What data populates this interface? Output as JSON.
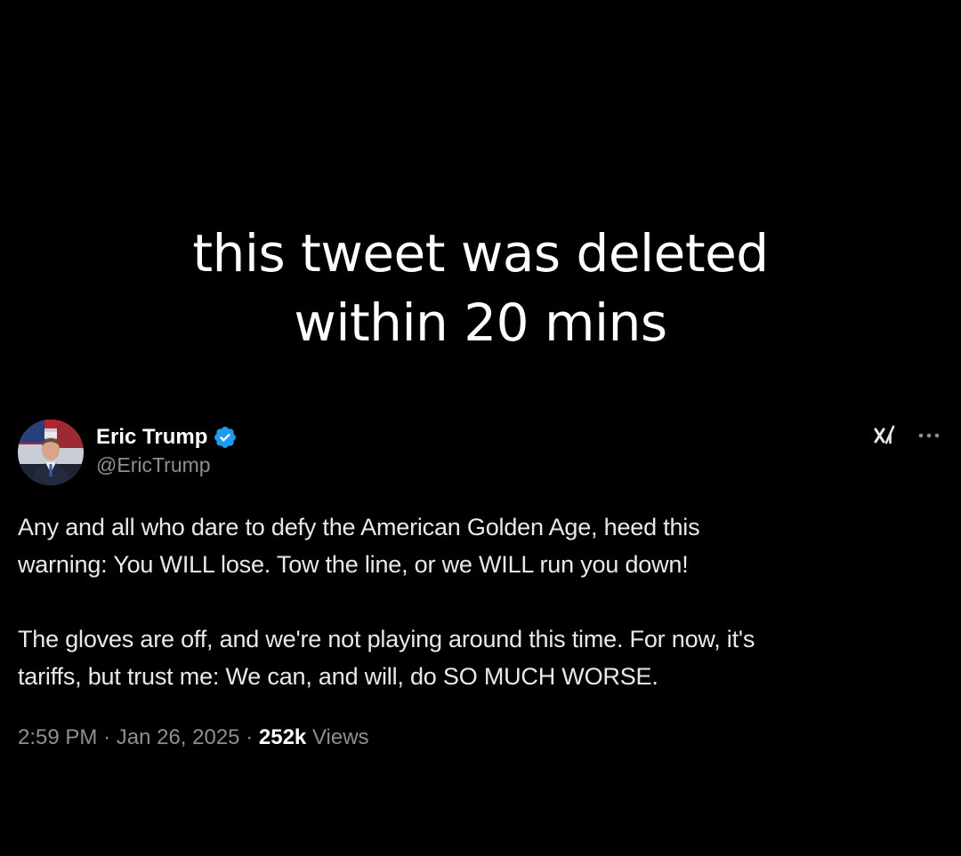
{
  "caption": {
    "line1": "this tweet was deleted",
    "line2": "within 20 mins"
  },
  "tweet": {
    "author": {
      "display_name": "Eric Trump",
      "handle": "@EricTrump",
      "verified": true,
      "verified_color": "#1d9bf0",
      "avatar_icon": "person-avatar"
    },
    "icons": {
      "grok": "grok-icon",
      "more": "more-options-icon"
    },
    "paragraphs": [
      {
        "line1": "Any and all who dare to defy the American Golden Age, heed this",
        "line2": "warning: You WILL lose. Tow the line, or we WILL run you down!"
      },
      {
        "line1": "The gloves are off, and we're not playing around this time. For now, it's",
        "line2": "tariffs, but trust me: We can, and will, do SO MUCH WORSE."
      }
    ],
    "time": "2:59 PM",
    "separator": "·",
    "date": "Jan 26, 2025",
    "views_count": "252k",
    "views_label": "Views"
  },
  "colors": {
    "background": "#000000",
    "text": "#e7e9ea",
    "secondary_text": "#8b8f94"
  }
}
